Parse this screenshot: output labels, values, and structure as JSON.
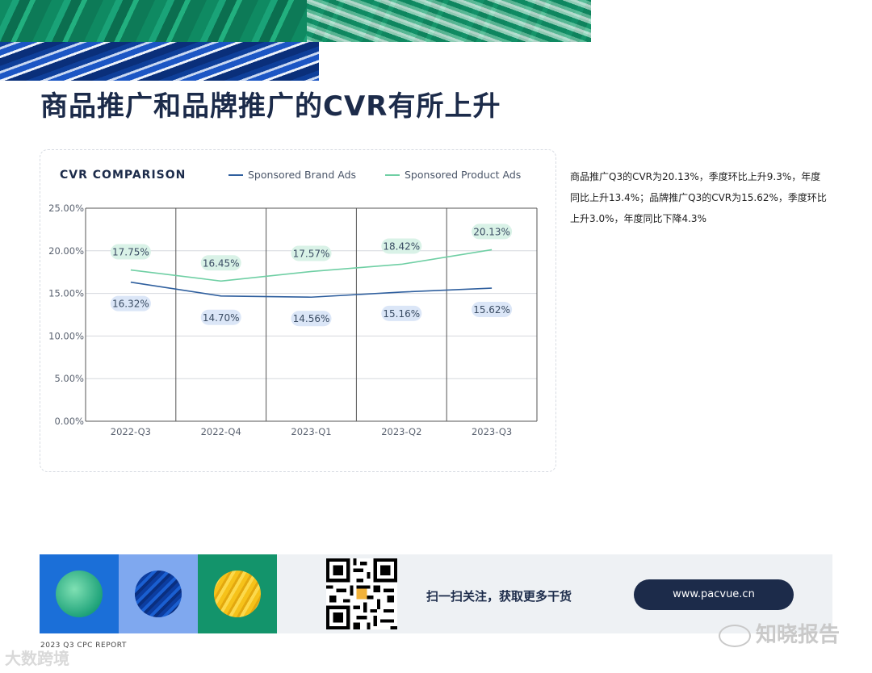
{
  "page": {
    "title": "商品推广和品牌推广的CVR有所上升",
    "description": "商品推广Q3的CVR为20.13%，季度环比上升9.3%，年度同比上升13.4%；品牌推广Q3的CVR为15.62%，季度环比上升3.0%，年度同比下降4.3%"
  },
  "chart_data": {
    "type": "line",
    "title": "CVR COMPARISON",
    "categories": [
      "2022-Q3",
      "2022-Q4",
      "2023-Q1",
      "2023-Q2",
      "2023-Q3"
    ],
    "series": [
      {
        "name": "Sponsored Brand Ads",
        "values": [
          16.32,
          14.7,
          14.56,
          15.16,
          15.62
        ],
        "labels": [
          "16.32%",
          "14.70%",
          "14.56%",
          "15.16%",
          "15.62%"
        ],
        "color": "#2f5f9e"
      },
      {
        "name": "Sponsored Product Ads",
        "values": [
          17.75,
          16.45,
          17.57,
          18.42,
          20.13
        ],
        "labels": [
          "17.75%",
          "16.45%",
          "17.57%",
          "18.42%",
          "20.13%"
        ],
        "color": "#6fcfa4"
      }
    ],
    "y_ticks": [
      "0.00%",
      "5.00%",
      "10.00%",
      "15.00%",
      "20.00%",
      "25.00%"
    ],
    "ylim": [
      0,
      25
    ],
    "legend_position": "top-right",
    "grid": true
  },
  "footer": {
    "cta": "扫一扫关注，获取更多干货",
    "url": "www.pacvue.cn",
    "report_label": "2023 Q3 CPC REPORT",
    "watermark_left": "大数跨境",
    "watermark_right": "知晓报告"
  }
}
